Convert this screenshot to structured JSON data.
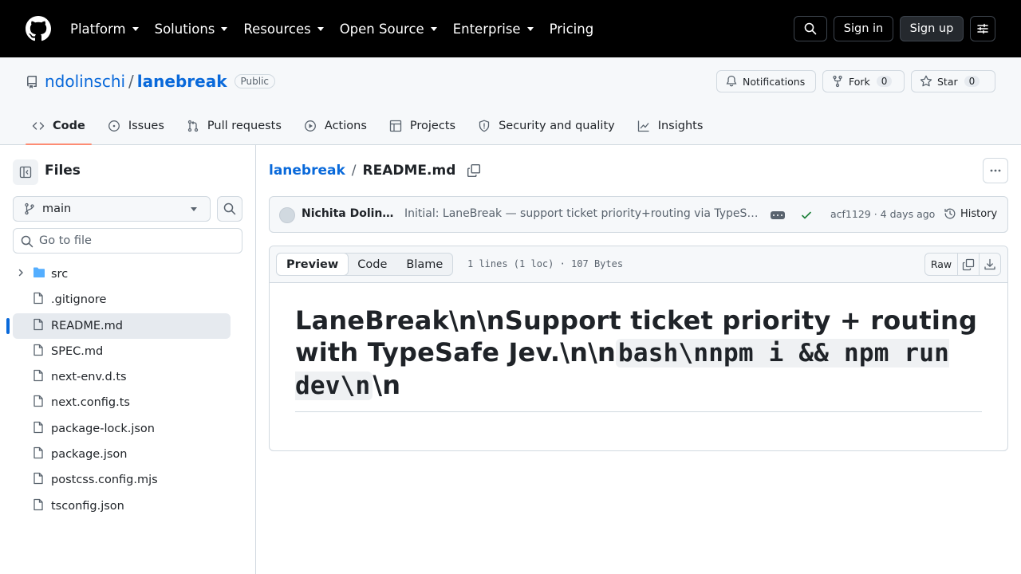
{
  "topbar": {
    "nav": [
      {
        "label": "Platform",
        "caret": true
      },
      {
        "label": "Solutions",
        "caret": true
      },
      {
        "label": "Resources",
        "caret": true
      },
      {
        "label": "Open Source",
        "caret": true
      },
      {
        "label": "Enterprise",
        "caret": true
      },
      {
        "label": "Pricing",
        "caret": false
      }
    ],
    "sign_in": "Sign in",
    "sign_up": "Sign up"
  },
  "repo": {
    "owner": "ndolinschi",
    "separator": "/",
    "name": "lanebreak",
    "visibility": "Public",
    "notifications_label": "Notifications",
    "fork_label": "Fork",
    "fork_count": "0",
    "star_label": "Star",
    "star_count": "0",
    "tabs": [
      {
        "label": "Code",
        "icon": "code-icon",
        "active": true
      },
      {
        "label": "Issues",
        "icon": "issue-icon",
        "active": false
      },
      {
        "label": "Pull requests",
        "icon": "pull-request-icon",
        "active": false
      },
      {
        "label": "Actions",
        "icon": "play-icon",
        "active": false
      },
      {
        "label": "Projects",
        "icon": "table-icon",
        "active": false
      },
      {
        "label": "Security and quality",
        "icon": "shield-icon",
        "active": false
      },
      {
        "label": "Insights",
        "icon": "graph-icon",
        "active": false
      }
    ]
  },
  "sidebar": {
    "title": "Files",
    "branch": "main",
    "goto_placeholder": "Go to file",
    "items": [
      {
        "name": "src",
        "type": "folder",
        "selected": false
      },
      {
        "name": ".gitignore",
        "type": "file",
        "selected": false
      },
      {
        "name": "README.md",
        "type": "file",
        "selected": true
      },
      {
        "name": "SPEC.md",
        "type": "file",
        "selected": false
      },
      {
        "name": "next-env.d.ts",
        "type": "file",
        "selected": false
      },
      {
        "name": "next.config.ts",
        "type": "file",
        "selected": false
      },
      {
        "name": "package-lock.json",
        "type": "file",
        "selected": false
      },
      {
        "name": "package.json",
        "type": "file",
        "selected": false
      },
      {
        "name": "postcss.config.mjs",
        "type": "file",
        "selected": false
      },
      {
        "name": "tsconfig.json",
        "type": "file",
        "selected": false
      }
    ]
  },
  "main": {
    "breadcrumb_repo": "lanebreak",
    "breadcrumb_sep": "/",
    "breadcrumb_file": "README.md",
    "commit": {
      "author": "Nichita Dolinschi",
      "message": "Initial: LaneBreak — support ticket priority+routing via TypeSafe Jev",
      "sha_time": "acf1129 · 4 days ago",
      "history_label": "History"
    },
    "file": {
      "tabs": [
        "Preview",
        "Code",
        "Blame"
      ],
      "meta": "1 lines (1 loc) · 107 Bytes",
      "raw_label": "Raw"
    },
    "readme": {
      "heading_text": "LaneBreak\\n\\nSupport ticket priority + routing with TypeSafe Jev.\\n\\n",
      "code_inline": "bash\\nnpm i && npm run dev\\n",
      "heading_tail": "\\n"
    }
  },
  "colors": {
    "link": "#0969da",
    "active_tab_underline": "#fd8c73",
    "topbar_bg": "#000000",
    "folder": "#54aeff",
    "success": "#1a7f37"
  }
}
